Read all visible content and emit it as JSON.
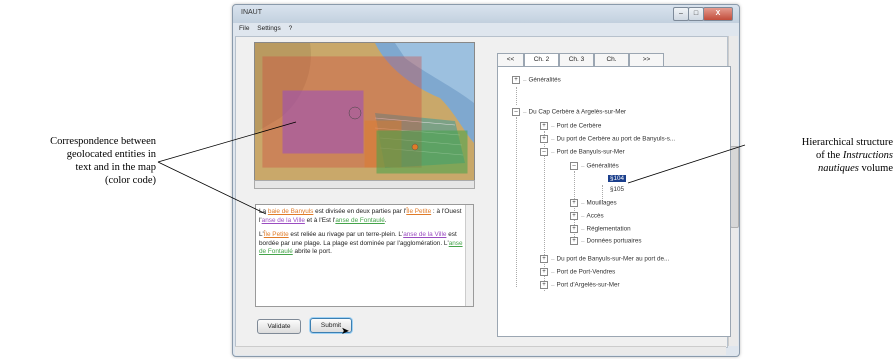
{
  "annotations": {
    "left": [
      "Correspondence between",
      "geolocated entities in",
      "text and in the map",
      "(color code)"
    ],
    "right_line1": "Hierarchical structure",
    "right_line2_prefix": "of the ",
    "right_line2_em": "Instructions",
    "right_line3_em": "nautiques",
    "right_line3_suffix": " volume"
  },
  "window": {
    "title": "INAUT",
    "controls": {
      "minimize": "–",
      "maximize": "□",
      "close": "X"
    },
    "menu": [
      "File",
      "Settings",
      "?"
    ]
  },
  "map": {
    "colors": {
      "sea": "#7fa8cf",
      "land": "#c9a86a",
      "orange": "#e07b28",
      "purple": "#9a4cc0",
      "green": "#45a44a",
      "red": "#d1443a"
    }
  },
  "text": {
    "p1": [
      {
        "t": "La ",
        "c": ""
      },
      {
        "t": "baie de Banyuls",
        "c": "orange"
      },
      {
        "t": " est divisée en deux parties par l'",
        "c": ""
      },
      {
        "t": "Île Petite",
        "c": "orange"
      },
      {
        "t": " : à l'Ouest l'",
        "c": ""
      },
      {
        "t": "anse de la Ville",
        "c": "purple"
      },
      {
        "t": " et à l'Est l'",
        "c": ""
      },
      {
        "t": "anse de Fontaulé",
        "c": "green"
      },
      {
        "t": ".",
        "c": ""
      }
    ],
    "p2": [
      {
        "t": "L'",
        "c": ""
      },
      {
        "t": "Île Petite",
        "c": "orange"
      },
      {
        "t": " est reliée au rivage par un terre-plein. L'",
        "c": ""
      },
      {
        "t": "anse de la Ville",
        "c": "purple"
      },
      {
        "t": " est bordée par une plage. La plage est dominée par l'agglomération. L'",
        "c": ""
      },
      {
        "t": "anse de Fontaulé",
        "c": "green"
      },
      {
        "t": " abrite le port.",
        "c": ""
      }
    ]
  },
  "buttons": {
    "validate": "Validate",
    "submit": "Submit"
  },
  "tabs": [
    "<<",
    "Ch. 2",
    "Ch. 3",
    "Ch.",
    ">>"
  ],
  "tree": {
    "generalites_top": "Généralités",
    "section": "Du Cap Cerbère à Argelès-sur-Mer",
    "port_cerbere": "Port de Cerbère",
    "port_cerbere_banyuls": "Du port de Cerbère au port de Banyuls-s...",
    "port_banyuls": "Port de Banyuls-sur-Mer",
    "generalites_sub": "Généralités",
    "p104": "§104",
    "p105": "§105",
    "mouillages": "Mouillages",
    "acces": "Accès",
    "reglementation": "Réglementation",
    "donnees": "Données portuaires",
    "port_banyuls_port": "Du port de Banyuls-sur-Mer au port de...",
    "port_vendres": "Port de Port-Vendres",
    "port_argeles": "Port d'Argelès-sur-Mer"
  }
}
